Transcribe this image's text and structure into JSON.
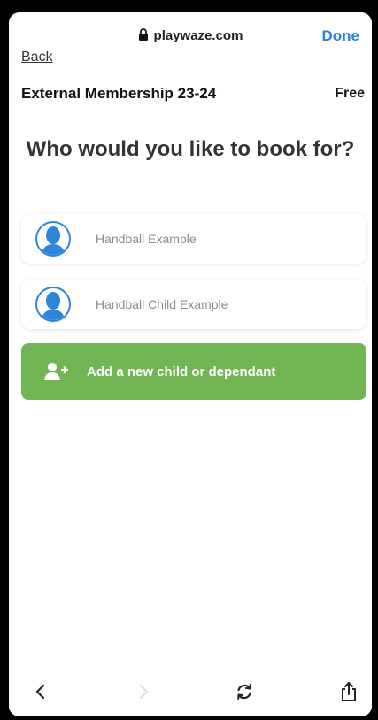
{
  "browser": {
    "url": "playwaze.com",
    "done_label": "Done",
    "back_label": "Back"
  },
  "booking": {
    "membership_title": "External Membership 23-24",
    "price": "Free",
    "question": "Who would you like to book for?",
    "people": [
      {
        "name": "Handball Example"
      },
      {
        "name": "Handball Child Example"
      }
    ],
    "add_label": "Add a new child or dependant"
  },
  "toolbar": {
    "icons": [
      "chevron-left-icon",
      "chevron-right-icon",
      "reload-icon",
      "share-icon"
    ]
  },
  "colors": {
    "accent_blue": "#2f7fe0",
    "button_green": "#72b555",
    "avatar_blue": "#2d86d9"
  }
}
